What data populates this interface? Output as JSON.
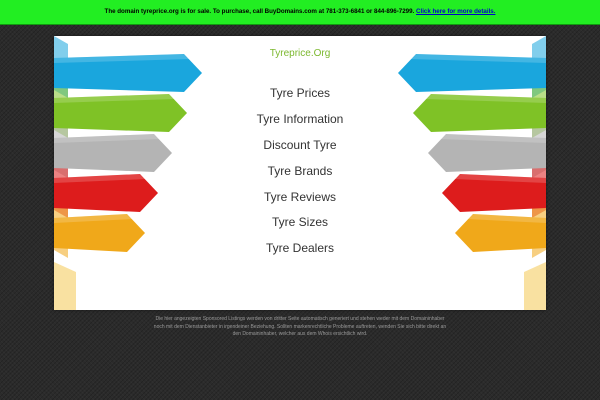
{
  "banner": {
    "text": "The domain tyreprice.org is for sale. To purchase, call BuyDomains.com at 781-373-6841 or 844-896-7299.",
    "link_label": "Click here for more details."
  },
  "site": {
    "title": "Tyreprice.Org"
  },
  "nav": {
    "links": [
      {
        "label": "Tyre Prices"
      },
      {
        "label": "Tyre Information"
      },
      {
        "label": "Discount Tyre"
      },
      {
        "label": "Tyre Brands"
      },
      {
        "label": "Tyre Reviews"
      },
      {
        "label": "Tyre Sizes"
      },
      {
        "label": "Tyre Dealers"
      }
    ]
  },
  "footer": {
    "disclaimer": "Die hier angezeigten Sponsored Listings werden von dritter Seite automatisch generiert und stehen weder mit dem Domaininhaber noch mit dem Dienstanbieter in irgendeiner Beziehung. Sollten markenrechtliche Probleme auftreten, wenden Sie sich bitte direkt an den Domaininhaber, welcher aus dem Whois ersichtlich wird."
  },
  "colors": {
    "banner_bg": "#22ee22",
    "ribbons": [
      "#1aa6dd",
      "#7fc226",
      "#b4b4b4",
      "#dd1c1c",
      "#f0a81a"
    ]
  }
}
